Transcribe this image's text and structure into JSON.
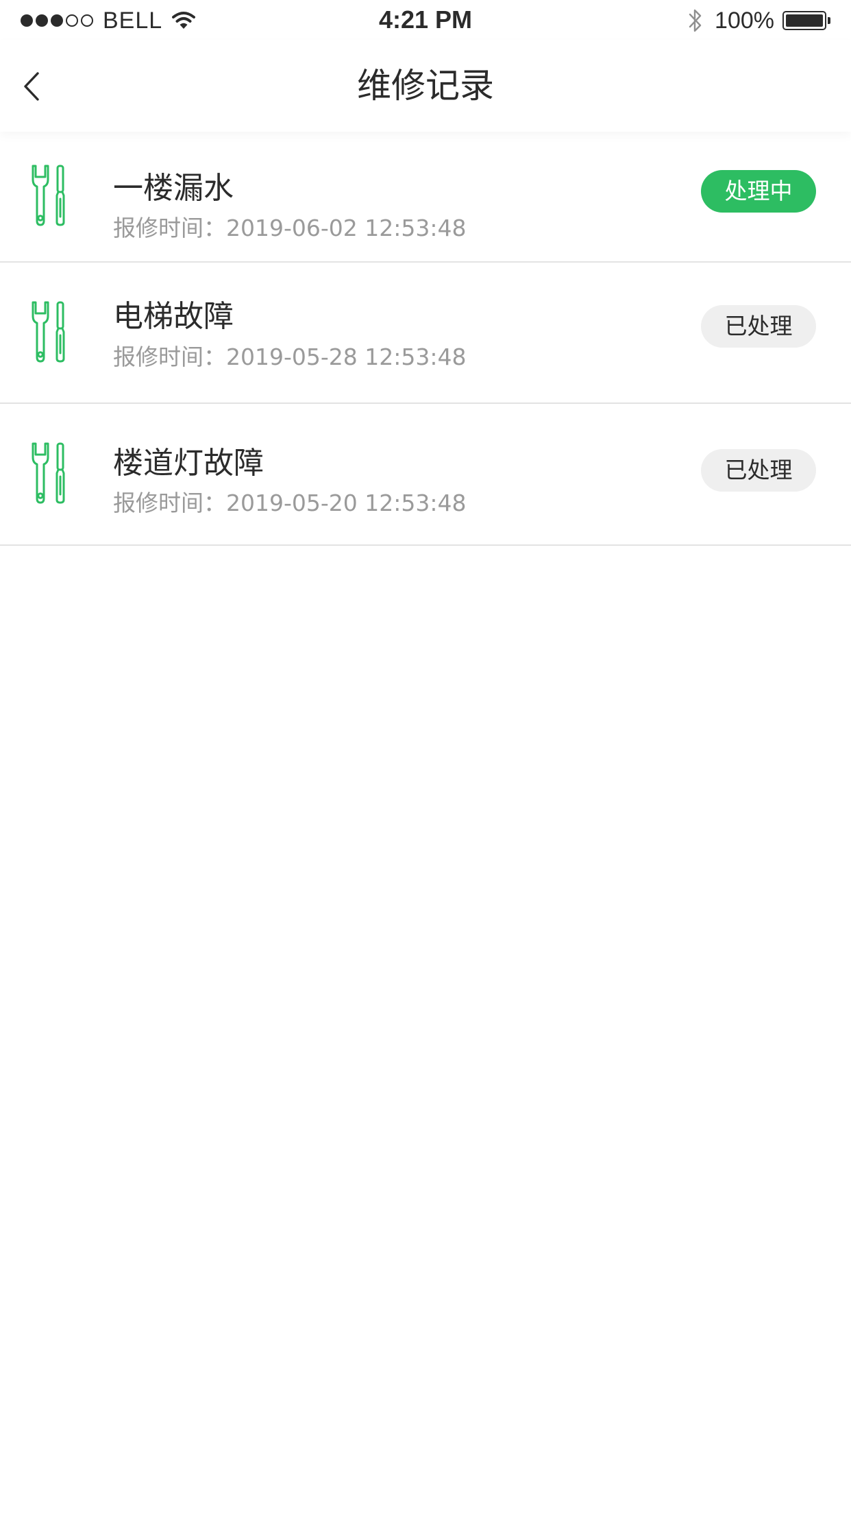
{
  "status_bar": {
    "carrier": "BELL",
    "time": "4:21 PM",
    "battery": "100%",
    "signal_strength": 3,
    "signal_max": 5
  },
  "nav": {
    "title": "维修记录",
    "back_icon": "chevron-left-icon"
  },
  "records": [
    {
      "title": "一楼漏水",
      "time_label": "报修时间：2019-06-02  12:53:48",
      "status": "处理中",
      "status_type": "processing",
      "icon": "repair-tools-icon"
    },
    {
      "title": "电梯故障",
      "time_label": "报修时间：2019-05-28  12:53:48",
      "status": "已处理",
      "status_type": "done",
      "icon": "repair-tools-icon"
    },
    {
      "title": "楼道灯故障",
      "time_label": "报修时间：2019-05-20  12:53:48",
      "status": "已处理",
      "status_type": "done",
      "icon": "repair-tools-icon"
    }
  ],
  "colors": {
    "accent": "#2dbd62",
    "icon": "#2dbd62",
    "badge_done_bg": "#efefef",
    "muted_text": "#9a9a9a",
    "divider": "#e3e3e3"
  }
}
